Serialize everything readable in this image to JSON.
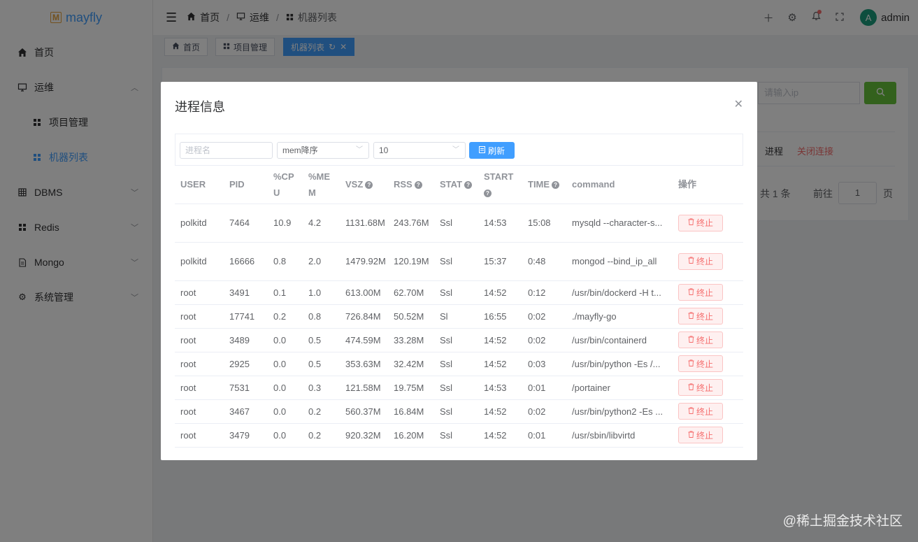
{
  "app": {
    "logo_text": "mayfly"
  },
  "sidebar": {
    "items": [
      {
        "label": "首页",
        "icon": "home-icon"
      },
      {
        "label": "运维",
        "icon": "monitor-icon",
        "expanded": true
      },
      {
        "label": "项目管理",
        "icon": "grid-icon"
      },
      {
        "label": "机器列表",
        "icon": "grid-icon",
        "active": true
      },
      {
        "label": "DBMS",
        "icon": "database-icon"
      },
      {
        "label": "Redis",
        "icon": "grid-icon"
      },
      {
        "label": "Mongo",
        "icon": "document-icon"
      },
      {
        "label": "系统管理",
        "icon": "gear-icon"
      }
    ]
  },
  "header": {
    "breadcrumb": [
      "首页",
      "运维",
      "机器列表"
    ],
    "breadcrumb_sep": "/",
    "user": {
      "avatar_letter": "A",
      "name": "admin"
    }
  },
  "tags": [
    {
      "label": "首页"
    },
    {
      "label": "项目管理"
    },
    {
      "label": "机器列表",
      "active": true
    }
  ],
  "background": {
    "search_placeholder": "请输入ip",
    "row_actions": {
      "process": "进程",
      "close_conn": "关闭连接"
    },
    "pagination": {
      "total": "共 1 条",
      "goto": "前往",
      "page": "1",
      "page_unit": "页"
    }
  },
  "dialog": {
    "title": "进程信息",
    "toolbar": {
      "name_placeholder": "进程名",
      "sort_value": "mem降序",
      "count_value": "10",
      "refresh_label": "刷新"
    },
    "columns": [
      "USER",
      "PID",
      "%CPU",
      "%MEM",
      "VSZ",
      "RSS",
      "STAT",
      "START",
      "TIME",
      "command",
      "操作"
    ],
    "kill_label": "终止",
    "rows": [
      {
        "user": "polkitd",
        "pid": "7464",
        "cpu": "10.9",
        "mem": "4.2",
        "vsz": "1131.68M",
        "rss": "243.76M",
        "stat": "Ssl",
        "start": "14:53",
        "time": "15:08",
        "command": "mysqld --character-s..."
      },
      {
        "user": "polkitd",
        "pid": "16666",
        "cpu": "0.8",
        "mem": "2.0",
        "vsz": "1479.92M",
        "rss": "120.19M",
        "stat": "Ssl",
        "start": "15:37",
        "time": "0:48",
        "command": "mongod --bind_ip_all"
      },
      {
        "user": "root",
        "pid": "3491",
        "cpu": "0.1",
        "mem": "1.0",
        "vsz": "613.00M",
        "rss": "62.70M",
        "stat": "Ssl",
        "start": "14:52",
        "time": "0:12",
        "command": "/usr/bin/dockerd -H t..."
      },
      {
        "user": "root",
        "pid": "17741",
        "cpu": "0.2",
        "mem": "0.8",
        "vsz": "726.84M",
        "rss": "50.52M",
        "stat": "Sl",
        "start": "16:55",
        "time": "0:02",
        "command": "./mayfly-go"
      },
      {
        "user": "root",
        "pid": "3489",
        "cpu": "0.0",
        "mem": "0.5",
        "vsz": "474.59M",
        "rss": "33.28M",
        "stat": "Ssl",
        "start": "14:52",
        "time": "0:02",
        "command": "/usr/bin/containerd"
      },
      {
        "user": "root",
        "pid": "2925",
        "cpu": "0.0",
        "mem": "0.5",
        "vsz": "353.63M",
        "rss": "32.42M",
        "stat": "Ssl",
        "start": "14:52",
        "time": "0:03",
        "command": "/usr/bin/python -Es /..."
      },
      {
        "user": "root",
        "pid": "7531",
        "cpu": "0.0",
        "mem": "0.3",
        "vsz": "121.58M",
        "rss": "19.75M",
        "stat": "Ssl",
        "start": "14:53",
        "time": "0:01",
        "command": "/portainer"
      },
      {
        "user": "root",
        "pid": "3467",
        "cpu": "0.0",
        "mem": "0.2",
        "vsz": "560.37M",
        "rss": "16.84M",
        "stat": "Ssl",
        "start": "14:52",
        "time": "0:02",
        "command": "/usr/bin/python2 -Es ..."
      },
      {
        "user": "root",
        "pid": "3479",
        "cpu": "0.0",
        "mem": "0.2",
        "vsz": "920.32M",
        "rss": "16.20M",
        "stat": "Ssl",
        "start": "14:52",
        "time": "0:01",
        "command": "/usr/sbin/libvirtd"
      }
    ]
  },
  "watermark": "@稀土掘金技术社区",
  "colors": {
    "primary": "#409eff",
    "danger": "#f56c6c",
    "success": "#67c23a",
    "avatar": "#1b9c7d"
  }
}
